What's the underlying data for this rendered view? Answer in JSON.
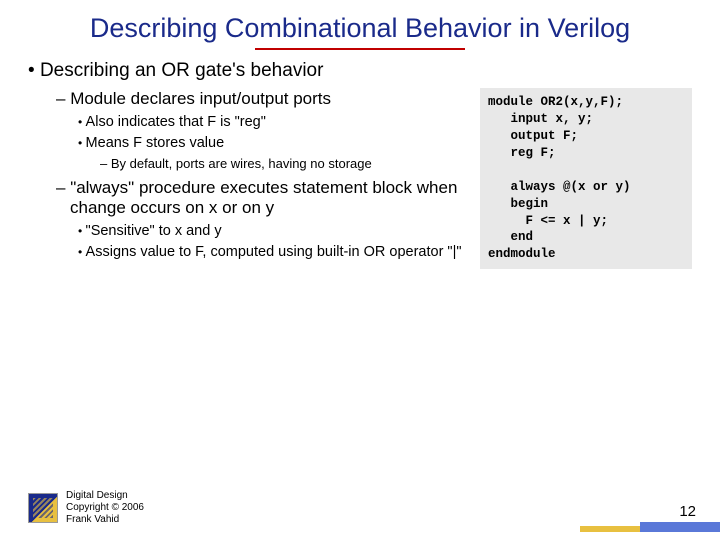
{
  "title": "Describing Combinational Behavior in Verilog",
  "bullets": {
    "l1": "Describing an OR gate's behavior",
    "l2a": "Module declares input/output ports",
    "l3a": "Also indicates that F is \"reg\"",
    "l3b": "Means F stores value",
    "l4a": "By default, ports are wires, having no storage",
    "l2b": "\"always\" procedure executes statement block when change occurs on x or on y",
    "l3c": "\"Sensitive\" to x and y",
    "l3d": "Assigns value to F, computed using built-in OR operator \"|\""
  },
  "code": "module OR2(x,y,F);\n   input x, y;\n   output F;\n   reg F;\n\n   always @(x or y)\n   begin\n     F <= x | y;\n   end\nendmodule",
  "footer": {
    "line1": "Digital Design",
    "line2": "Copyright © 2006",
    "line3": "Frank Vahid"
  },
  "page": "12"
}
